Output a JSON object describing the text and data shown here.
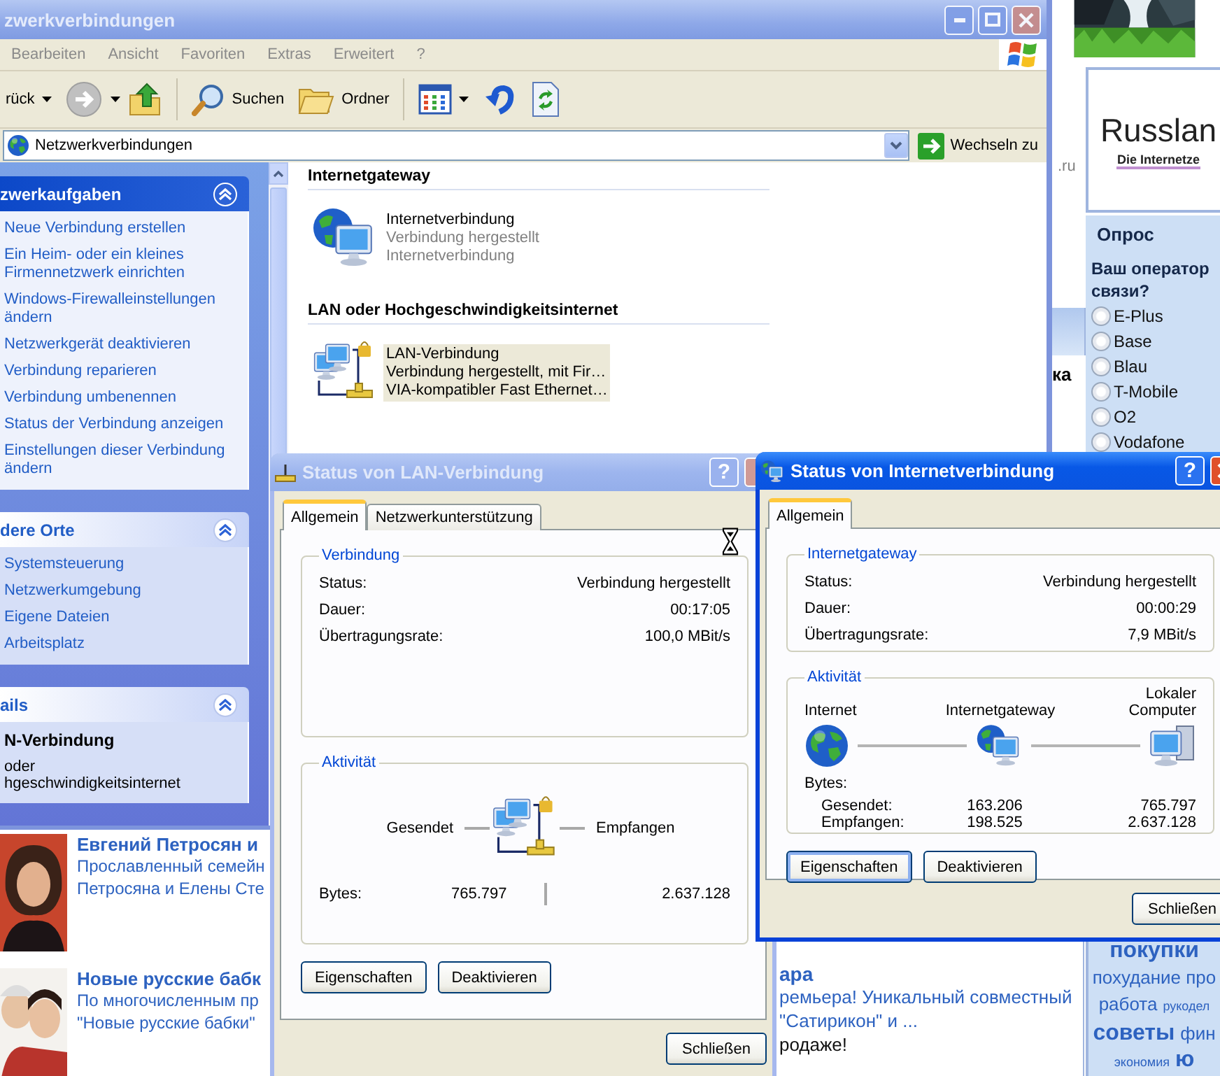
{
  "explorer": {
    "title": "zwerkverbindungen",
    "active": false,
    "menu": [
      "Bearbeiten",
      "Ansicht",
      "Favoriten",
      "Extras",
      "Erweitert",
      "?"
    ],
    "toolbar": [
      {
        "kind": "back",
        "label": "rück"
      },
      {
        "kind": "forward"
      },
      {
        "kind": "up"
      },
      {
        "kind": "search",
        "label": "Suchen"
      },
      {
        "kind": "folders",
        "label": "Ordner"
      },
      {
        "kind": "views"
      },
      {
        "kind": "undo"
      },
      {
        "kind": "refresh"
      }
    ],
    "address": {
      "value": "Netzwerkverbindungen",
      "go": "Wechseln zu"
    },
    "task_panes": [
      {
        "kind": "primary",
        "title": "zwerkaufgaben",
        "expanded": true,
        "links": [
          "Neue Verbindung erstellen",
          "Ein Heim- oder ein kleines Firmennetzwerk einrichten",
          "Windows-Firewalleinstellungen ändern",
          "Netzwerkgerät deaktivieren",
          "Verbindung reparieren",
          "Verbindung umbenennen",
          "Status der Verbindung anzeigen",
          "Einstellungen dieser Verbindung ändern"
        ]
      },
      {
        "kind": "secondary",
        "title": "dere Orte",
        "expanded": true,
        "links": [
          "Systemsteuerung",
          "Netzwerkumgebung",
          "Eigene Dateien",
          "Arbeitsplatz"
        ]
      },
      {
        "kind": "details",
        "title": "ails",
        "expanded": true,
        "name": "N-Verbindung",
        "lines": [
          "oder",
          "hgeschwindigkeitsinternet"
        ]
      }
    ],
    "groups": [
      {
        "title": "Internetgateway",
        "items": [
          {
            "kind": "gateway",
            "name": "Internetverbindung",
            "lines": [
              "Verbindung hergestellt",
              "Internetverbindung"
            ],
            "selected": false
          }
        ]
      },
      {
        "title": "LAN oder Hochgeschwindigkeitsinternet",
        "items": [
          {
            "kind": "lan",
            "name": "LAN-Verbindung",
            "lines": [
              "Verbindung hergestellt, mit Fir…",
              "VIA-kompatibler Fast Ethernet…"
            ],
            "selected": true
          }
        ]
      }
    ]
  },
  "web_page": {
    "site": ".ru",
    "logo": {
      "name": "Russlan",
      "tagline": "Die Internetze"
    },
    "snippet": "ка",
    "poll": {
      "title": "Опрос",
      "question": "Ваш оператор связи?",
      "options": [
        {
          "label": "E-Plus",
          "selected": false
        },
        {
          "label": "Base",
          "selected": false
        },
        {
          "label": "Blau",
          "selected": false
        },
        {
          "label": "T-Mobile",
          "selected": false
        },
        {
          "label": "O2",
          "selected": false
        },
        {
          "label": "Vodafone",
          "selected": false
        }
      ]
    },
    "news": [
      {
        "title": "Евгений Петросян и",
        "lines": [
          "Прославленный семейн",
          "Петросяна и Елены Сте"
        ]
      },
      {
        "title": "Новые русские бабк",
        "lines": [
          "По многочисленным пр",
          "\"Новые русские бабки\""
        ]
      }
    ],
    "feature": {
      "title": "ара",
      "lines": [
        "ремьера! Уникальный совместный",
        "\"Сатирикон\" и ..."
      ],
      "note": "родаже!"
    },
    "tags": [
      [
        {
          "text": "покупки",
          "kind": "big"
        }
      ],
      [
        {
          "text": "похудание про",
          "kind": "mid"
        }
      ],
      [
        {
          "text": "работа",
          "kind": "mid"
        },
        {
          "text": "рукодел",
          "kind": "small"
        }
      ],
      [
        {
          "text": "советы",
          "kind": "big"
        },
        {
          "text": "фин",
          "kind": "mid"
        }
      ],
      [
        {
          "text": "экономия",
          "kind": "small"
        },
        {
          "text": "ю",
          "kind": "big"
        }
      ]
    ]
  },
  "dialogs": [
    {
      "kind": "lan",
      "title": "Status von LAN-Verbindung",
      "active": false,
      "help": "?",
      "tabs": [
        {
          "label": "Allgemein",
          "selected": true
        },
        {
          "label": "Netzwerkunterstützung",
          "selected": false
        }
      ],
      "connection": {
        "title": "Verbindung",
        "rows": [
          {
            "label": "Status:",
            "value": "Verbindung hergestellt"
          },
          {
            "label": "Dauer:",
            "value": "00:17:05"
          },
          {
            "label": "Übertragungsrate:",
            "value": "100,0 MBit/s"
          }
        ]
      },
      "activity": {
        "title": "Aktivität",
        "sent": "Gesendet",
        "received": "Empfangen",
        "bytes_label": "Bytes:",
        "bytes_sent": "765.797",
        "bytes_received": "2.637.128"
      },
      "buttons": [
        {
          "label": "Eigenschaften",
          "focused": false
        },
        {
          "label": "Deaktivieren",
          "focused": false
        }
      ],
      "close": "Schließen"
    },
    {
      "kind": "gateway",
      "title": "Status von Internetverbindung",
      "active": true,
      "help": "?",
      "tabs": [
        {
          "label": "Allgemein",
          "selected": true
        }
      ],
      "connection": {
        "title": "Internetgateway",
        "rows": [
          {
            "label": "Status:",
            "value": "Verbindung hergestellt"
          },
          {
            "label": "Dauer:",
            "value": "00:00:29"
          },
          {
            "label": "Übertragungsrate:",
            "value": "7,9 MBit/s"
          }
        ]
      },
      "activity": {
        "title": "Aktivität",
        "columns": [
          "Internet",
          "Internetgateway",
          "Lokaler Computer"
        ],
        "bytes_label": "Bytes:",
        "rows": [
          {
            "label": "Gesendet:",
            "values": [
              "163.206",
              "765.797"
            ]
          },
          {
            "label": "Empfangen:",
            "values": [
              "198.525",
              "2.637.128"
            ]
          }
        ]
      },
      "buttons": [
        {
          "label": "Eigenschaften",
          "focused": true
        },
        {
          "label": "Deaktivieren",
          "focused": false
        }
      ],
      "close": "Schließen"
    }
  ]
}
